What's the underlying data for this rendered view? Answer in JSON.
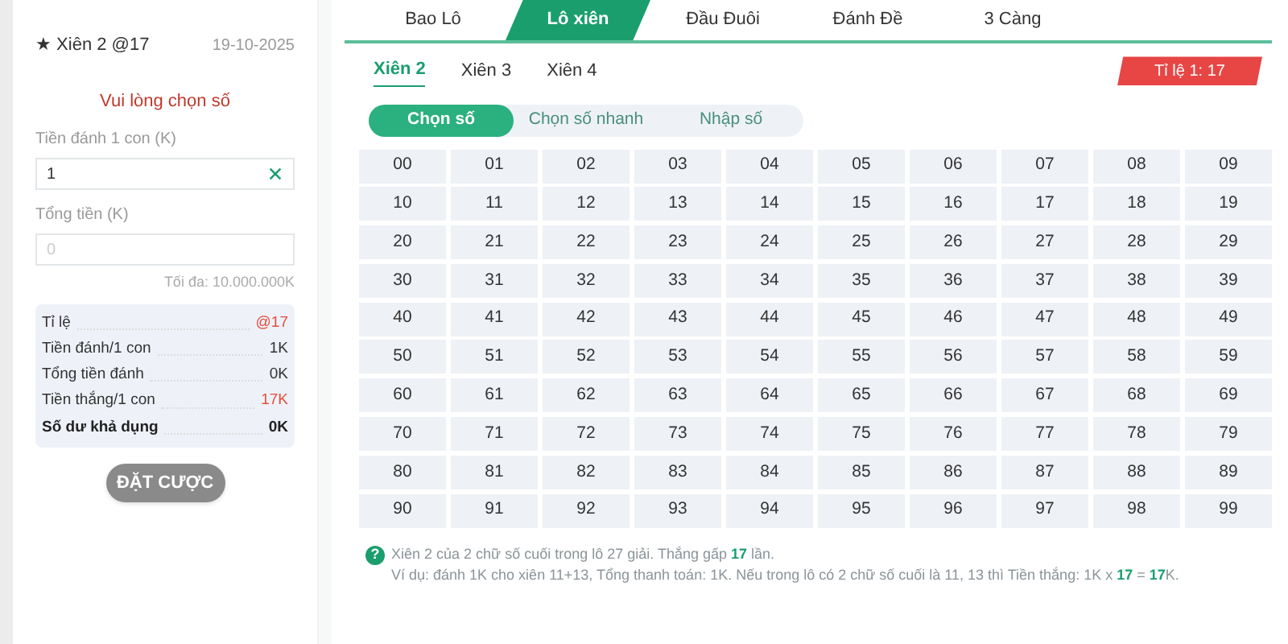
{
  "bet_slip": {
    "title": "★ Xiên 2 @17",
    "date": "19-10-2025",
    "warning": "Vui lòng chọn số",
    "stake_label": "Tiền đánh 1 con (K)",
    "stake_value": "1",
    "total_label": "Tổng tiền (K)",
    "total_placeholder": "0",
    "max_note": "Tối đa: 10.000.000K",
    "summary": [
      {
        "label": "Tỉ lệ",
        "value": "@17",
        "kind": "highlight"
      },
      {
        "label": "Tiền đánh/1 con",
        "value": "1K",
        "kind": "normal"
      },
      {
        "label": "Tổng tiền đánh",
        "value": "0K",
        "kind": "normal"
      },
      {
        "label": "Tiền thắng/1 con",
        "value": "17K",
        "kind": "highlight"
      },
      {
        "label": "Số dư khả dụng",
        "value": "0K",
        "kind": "bold"
      }
    ],
    "submit": {
      "label": "ĐẶT CƯỢC",
      "disabled": true
    }
  },
  "tabs": [
    {
      "label": "Bao Lô",
      "selected": false
    },
    {
      "label": "Lô xiên",
      "selected": true
    },
    {
      "label": "Đầu Đuôi",
      "selected": false
    },
    {
      "label": "Đánh Đề",
      "selected": false
    },
    {
      "label": "3 Càng",
      "selected": false
    }
  ],
  "sub_tabs": [
    {
      "label": "Xiên 2",
      "selected": true
    },
    {
      "label": "Xiên 3",
      "selected": false
    },
    {
      "label": "Xiên 4",
      "selected": false
    }
  ],
  "odds_badge": "Tỉ lệ 1: 17",
  "modes": [
    {
      "label": "Chọn số",
      "selected": true
    },
    {
      "label": "Chọn số nhanh",
      "selected": false
    },
    {
      "label": "Nhập số",
      "selected": false
    }
  ],
  "numbers": [
    {
      "label": "00",
      "selected": false
    },
    {
      "label": "01",
      "selected": false
    },
    {
      "label": "02",
      "selected": false
    },
    {
      "label": "03",
      "selected": false
    },
    {
      "label": "04",
      "selected": false
    },
    {
      "label": "05",
      "selected": false
    },
    {
      "label": "06",
      "selected": false
    },
    {
      "label": "07",
      "selected": false
    },
    {
      "label": "08",
      "selected": false
    },
    {
      "label": "09",
      "selected": false
    },
    {
      "label": "10",
      "selected": false
    },
    {
      "label": "11",
      "selected": false
    },
    {
      "label": "12",
      "selected": false
    },
    {
      "label": "13",
      "selected": false
    },
    {
      "label": "14",
      "selected": false
    },
    {
      "label": "15",
      "selected": false
    },
    {
      "label": "16",
      "selected": false
    },
    {
      "label": "17",
      "selected": false
    },
    {
      "label": "18",
      "selected": false
    },
    {
      "label": "19",
      "selected": false
    },
    {
      "label": "20",
      "selected": false
    },
    {
      "label": "21",
      "selected": false
    },
    {
      "label": "22",
      "selected": false
    },
    {
      "label": "23",
      "selected": false
    },
    {
      "label": "24",
      "selected": false
    },
    {
      "label": "25",
      "selected": false
    },
    {
      "label": "26",
      "selected": false
    },
    {
      "label": "27",
      "selected": false
    },
    {
      "label": "28",
      "selected": false
    },
    {
      "label": "29",
      "selected": false
    },
    {
      "label": "30",
      "selected": false
    },
    {
      "label": "31",
      "selected": false
    },
    {
      "label": "32",
      "selected": false
    },
    {
      "label": "33",
      "selected": false
    },
    {
      "label": "34",
      "selected": false
    },
    {
      "label": "35",
      "selected": false
    },
    {
      "label": "36",
      "selected": false
    },
    {
      "label": "37",
      "selected": false
    },
    {
      "label": "38",
      "selected": false
    },
    {
      "label": "39",
      "selected": false
    },
    {
      "label": "40",
      "selected": false
    },
    {
      "label": "41",
      "selected": false
    },
    {
      "label": "42",
      "selected": false
    },
    {
      "label": "43",
      "selected": false
    },
    {
      "label": "44",
      "selected": false
    },
    {
      "label": "45",
      "selected": false
    },
    {
      "label": "46",
      "selected": false
    },
    {
      "label": "47",
      "selected": false
    },
    {
      "label": "48",
      "selected": false
    },
    {
      "label": "49",
      "selected": false
    },
    {
      "label": "50",
      "selected": false
    },
    {
      "label": "51",
      "selected": false
    },
    {
      "label": "52",
      "selected": false
    },
    {
      "label": "53",
      "selected": false
    },
    {
      "label": "54",
      "selected": false
    },
    {
      "label": "55",
      "selected": false
    },
    {
      "label": "56",
      "selected": false
    },
    {
      "label": "57",
      "selected": false
    },
    {
      "label": "58",
      "selected": false
    },
    {
      "label": "59",
      "selected": false
    },
    {
      "label": "60",
      "selected": false
    },
    {
      "label": "61",
      "selected": false
    },
    {
      "label": "62",
      "selected": false
    },
    {
      "label": "63",
      "selected": false
    },
    {
      "label": "64",
      "selected": false
    },
    {
      "label": "65",
      "selected": false
    },
    {
      "label": "66",
      "selected": false
    },
    {
      "label": "67",
      "selected": false
    },
    {
      "label": "68",
      "selected": false
    },
    {
      "label": "69",
      "selected": false
    },
    {
      "label": "70",
      "selected": false
    },
    {
      "label": "71",
      "selected": false
    },
    {
      "label": "72",
      "selected": false
    },
    {
      "label": "73",
      "selected": false
    },
    {
      "label": "74",
      "selected": false
    },
    {
      "label": "75",
      "selected": false
    },
    {
      "label": "76",
      "selected": false
    },
    {
      "label": "77",
      "selected": false
    },
    {
      "label": "78",
      "selected": false
    },
    {
      "label": "79",
      "selected": false
    },
    {
      "label": "80",
      "selected": false
    },
    {
      "label": "81",
      "selected": false
    },
    {
      "label": "82",
      "selected": false
    },
    {
      "label": "83",
      "selected": false
    },
    {
      "label": "84",
      "selected": false
    },
    {
      "label": "85",
      "selected": false
    },
    {
      "label": "86",
      "selected": false
    },
    {
      "label": "87",
      "selected": false
    },
    {
      "label": "88",
      "selected": false
    },
    {
      "label": "89",
      "selected": false
    },
    {
      "label": "90",
      "selected": false
    },
    {
      "label": "91",
      "selected": false
    },
    {
      "label": "92",
      "selected": false
    },
    {
      "label": "93",
      "selected": false
    },
    {
      "label": "94",
      "selected": false
    },
    {
      "label": "95",
      "selected": false
    },
    {
      "label": "96",
      "selected": false
    },
    {
      "label": "97",
      "selected": false
    },
    {
      "label": "98",
      "selected": false
    },
    {
      "label": "99",
      "selected": false
    }
  ],
  "help": {
    "icon": "?",
    "lines": [
      "Xiên 2 của 2 chữ số cuối trong lô 27 giải. Thắng gấp **17** lần.",
      "Ví dụ: đánh 1K cho xiên 11+13, Tổng thanh toán: 1K. Nếu trong lô có 2 chữ số cuối là 11, 13 thì Tiền thắng: 1K x **17** = **17**K."
    ]
  }
}
